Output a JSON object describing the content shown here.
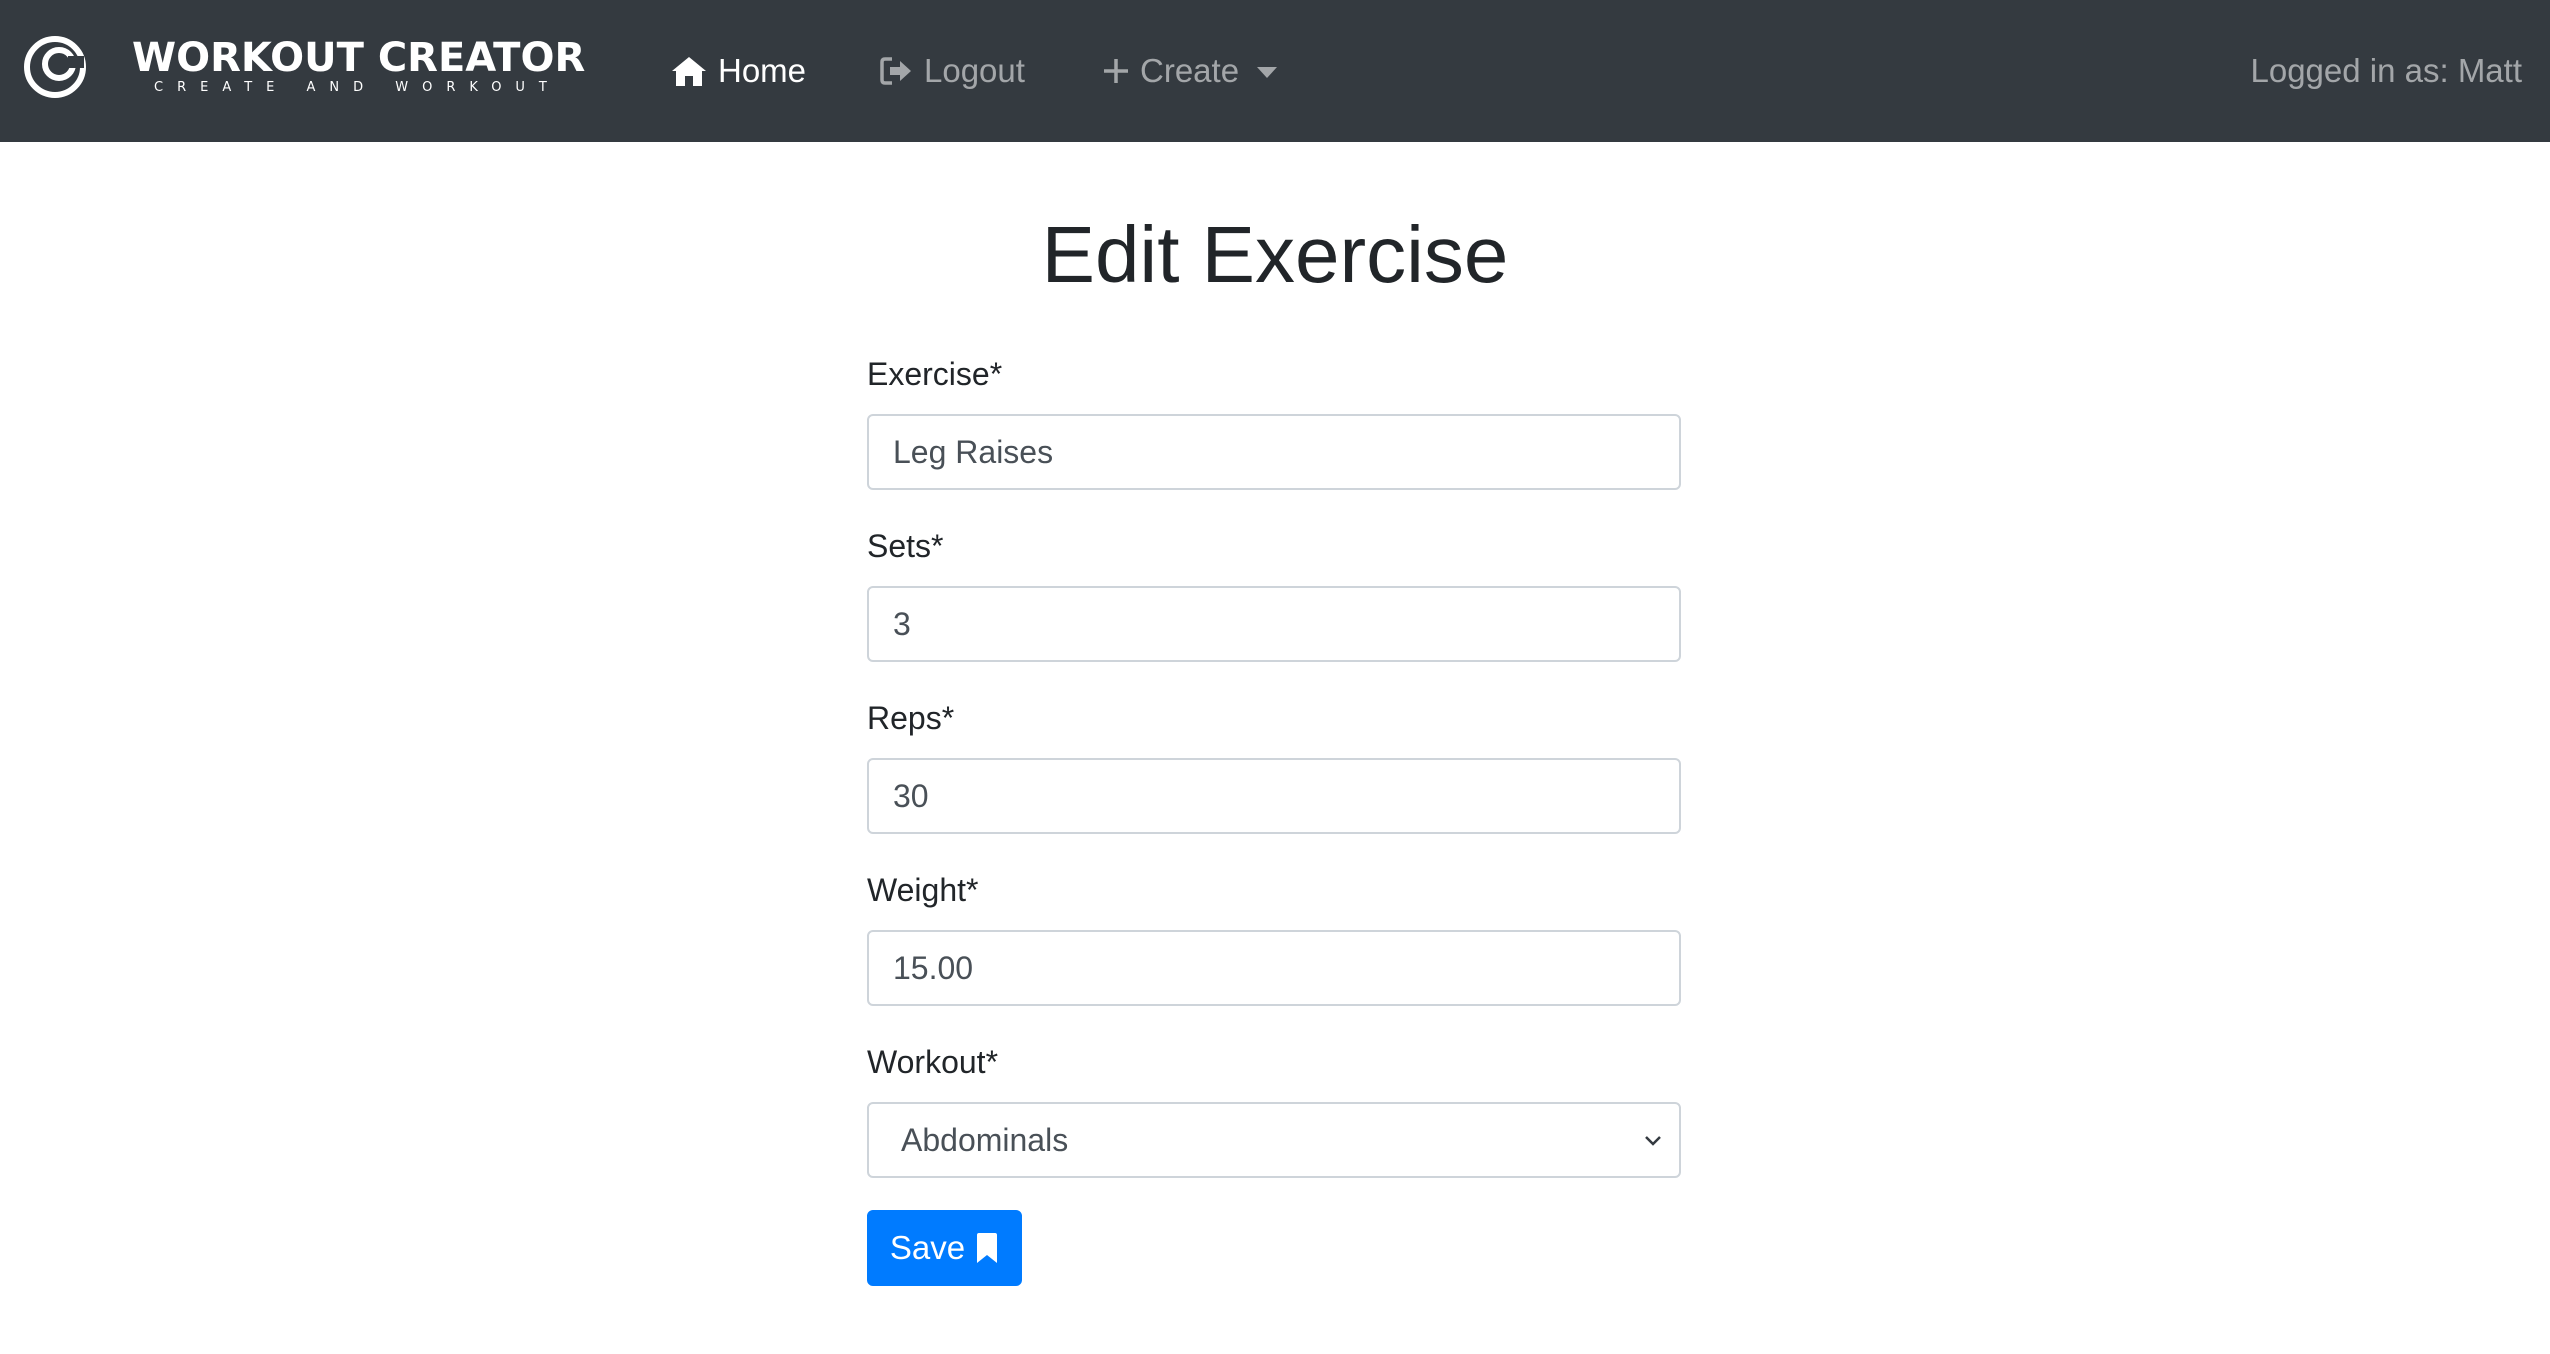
{
  "navbar": {
    "brand_title": "WORKOUT CREATOR",
    "brand_tagline": "CREATE AND WORKOUT",
    "items": [
      {
        "label": "Home",
        "icon": "home-icon",
        "active": true
      },
      {
        "label": "Logout",
        "icon": "sign-out-icon",
        "active": false
      },
      {
        "label": "Create",
        "icon": "plus-icon",
        "active": false,
        "dropdown": true
      }
    ],
    "logged_in": "Logged in as: Matt"
  },
  "page": {
    "title": "Edit Exercise"
  },
  "form": {
    "exercise": {
      "label": "Exercise*",
      "value": "Leg Raises"
    },
    "sets": {
      "label": "Sets*",
      "value": "3"
    },
    "reps": {
      "label": "Reps*",
      "value": "30"
    },
    "weight": {
      "label": "Weight*",
      "value": "15.00"
    },
    "workout": {
      "label": "Workout*",
      "selected": "Abdominals"
    },
    "save_label": "Save"
  },
  "colors": {
    "navbar_bg": "#343a40",
    "primary": "#007bff",
    "text": "#212529",
    "input_border": "#ced4da"
  }
}
